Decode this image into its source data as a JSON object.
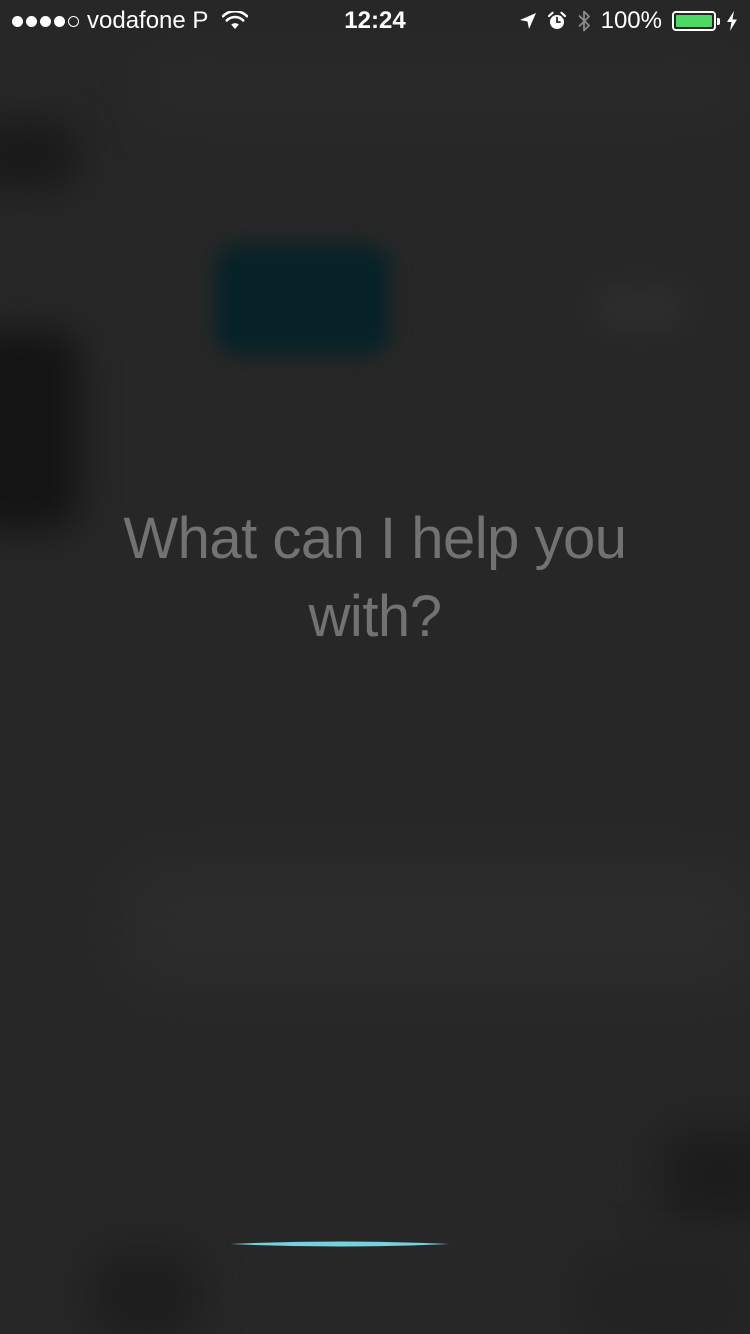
{
  "status_bar": {
    "signal_bars": [
      true,
      true,
      true,
      true,
      false
    ],
    "carrier": "vodafone P",
    "wifi_icon": "wifi-icon",
    "time": "12:24",
    "location_icon": "location-arrow-icon",
    "alarm_icon": "alarm-clock-icon",
    "bluetooth_icon": "bluetooth-icon",
    "battery_percent": "100%",
    "battery_level": 1.0,
    "battery_color": "#4cd964",
    "charging_icon": "charging-bolt-icon"
  },
  "siri": {
    "prompt": "What can I help you with?",
    "waveform_color": "#7fe6f2"
  }
}
